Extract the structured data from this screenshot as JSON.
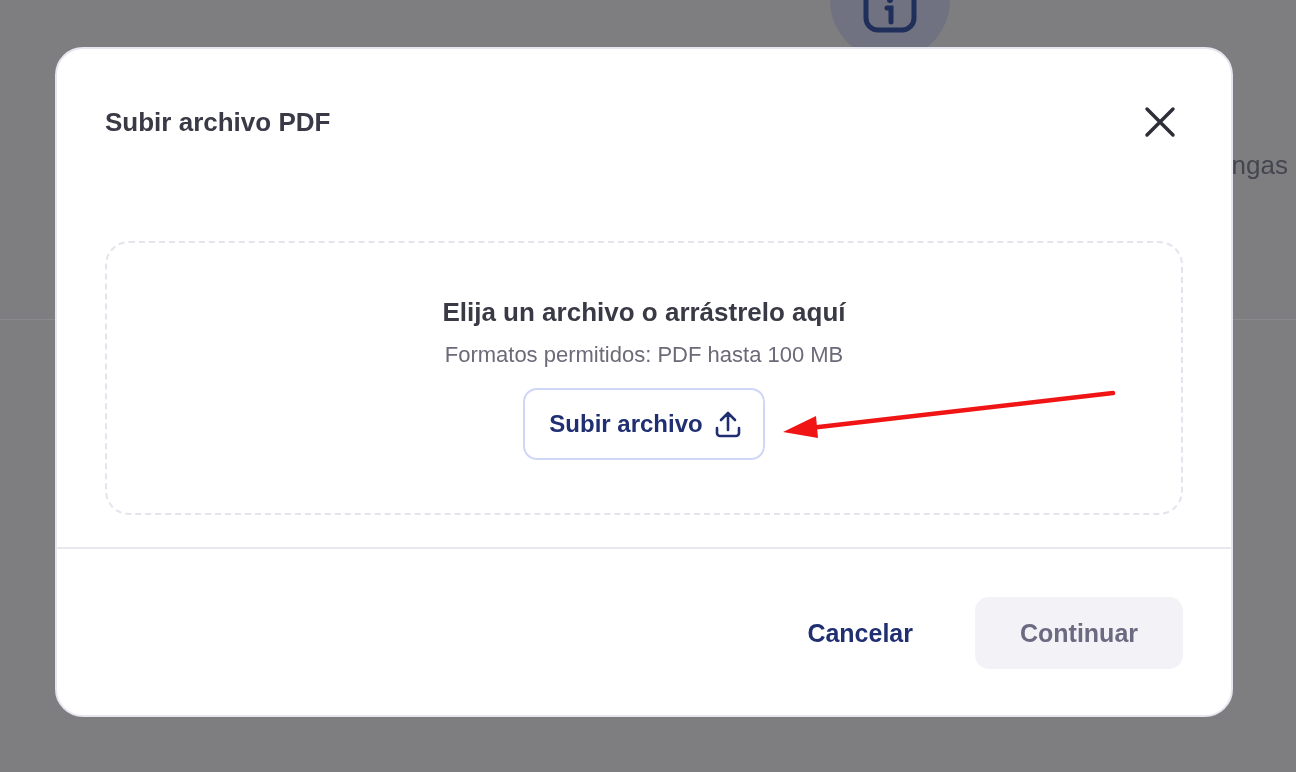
{
  "background": {
    "text": "ngas"
  },
  "modal": {
    "title": "Subir archivo PDF",
    "dropzone": {
      "heading": "Elija un archivo o arrástrelo aquí",
      "hint": "Formatos permitidos: PDF hasta 100 MB",
      "upload_button": "Subir archivo"
    },
    "buttons": [
      {
        "label": "Cancelar",
        "kind": "text",
        "disabled": false
      },
      {
        "label": "Continuar",
        "kind": "filled",
        "disabled": true
      }
    ]
  }
}
